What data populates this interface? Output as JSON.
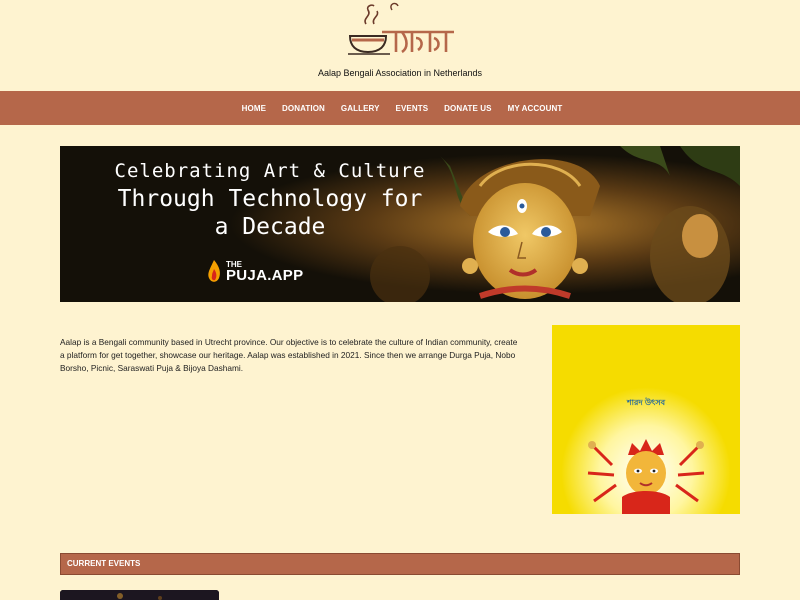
{
  "site": {
    "tagline": "Aalap Bengali Association in Netherlands"
  },
  "logo": {
    "alt": "আলাপ"
  },
  "nav": {
    "items": [
      {
        "label": "HOME"
      },
      {
        "label": "DONATION"
      },
      {
        "label": "GALLERY"
      },
      {
        "label": "EVENTS"
      },
      {
        "label": "DONATE US"
      },
      {
        "label": "MY ACCOUNT"
      }
    ]
  },
  "banner": {
    "line1": "Celebrating Art & Culture",
    "line2": "Through Technology for",
    "line3": "a Decade",
    "brand_the": "THE",
    "brand_name": "PUJA.APP"
  },
  "about": {
    "text": "Aalap is a Bengali community based in Utrecht province. Our objective is to celebrate the culture of Indian community, create a platform for get together, showcase our heritage. Aalap was established in 2021. Since then we arrange Durga Puja, Nobo Borsho, Picnic, Saraswati Puja & Bijoya Dashami."
  },
  "poster": {
    "title": "শারদ উৎসব"
  },
  "events": {
    "section_title": "CURRENT EVENTS"
  },
  "colors": {
    "background": "#fef3d0",
    "nav": "#b5674a",
    "poster": "#f5dc00"
  },
  "icons": {
    "logo": "aalap-teacup-logo",
    "brand": "flame-icon"
  }
}
